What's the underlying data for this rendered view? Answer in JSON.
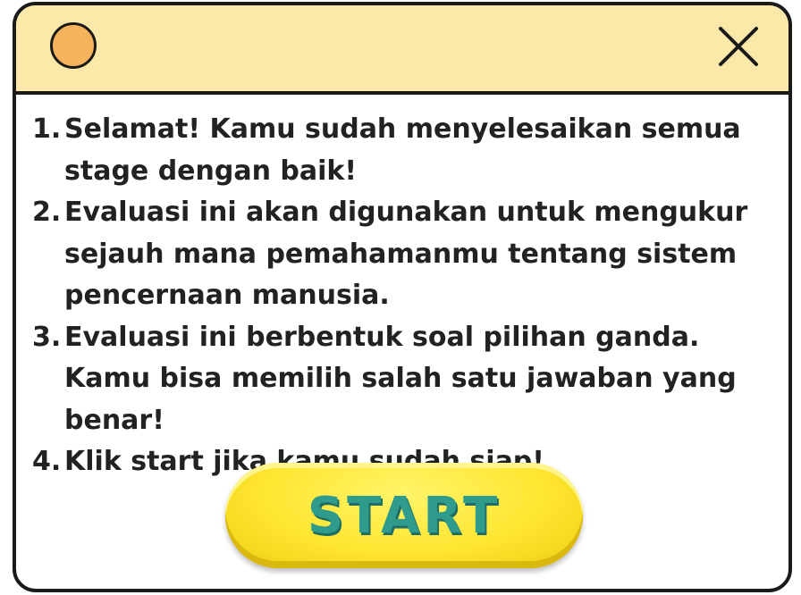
{
  "titlebar": {
    "circle_icon": "orange-circle-icon",
    "close_icon": "close-icon"
  },
  "instructions": [
    {
      "num": "1.",
      "text": "Selamat! Kamu sudah menyelesaikan semua stage dengan baik!"
    },
    {
      "num": "2.",
      "text": "Evaluasi ini akan digunakan untuk mengukur sejauh mana pemahamanmu tentang sistem pencernaan manusia."
    },
    {
      "num": "3.",
      "text": "Evaluasi ini berbentuk soal pilihan ganda. Kamu bisa memilih salah satu jawaban yang benar!"
    },
    {
      "num": "4.",
      "text": "Klik start jika kamu sudah siap!"
    }
  ],
  "start_button": {
    "label": "START"
  },
  "colors": {
    "titlebar": "#fce8a8",
    "circle": "#f5b35c",
    "button": "#ffe631",
    "button_text": "#2e9b8c"
  }
}
